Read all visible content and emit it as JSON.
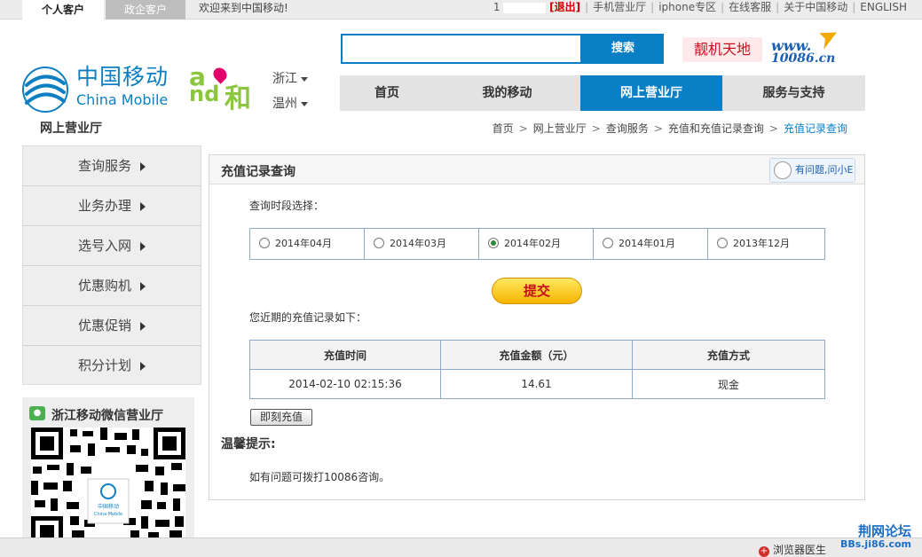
{
  "topbar": {
    "tabs": [
      "个人客户",
      "政企客户"
    ],
    "welcome": "欢迎来到中国移动!",
    "user": "1",
    "logout": "[退出]",
    "links": [
      "手机营业厅",
      "iphone专区",
      "在线客服",
      "关于中国移动",
      "ENGLISH"
    ]
  },
  "logo": {
    "cn": "中国移动",
    "en": "China Mobile"
  },
  "and_logo": {
    "a": "a",
    "nd": "nd",
    "he": "和"
  },
  "region": {
    "province": "浙江",
    "city": "温州"
  },
  "search": {
    "button": "搜索",
    "value": ""
  },
  "promo": {
    "label": "靓机天地",
    "url_line1": "www.",
    "url_line2": "10086.cn"
  },
  "nav": [
    "首页",
    "我的移动",
    "网上营业厅",
    "服务与支持"
  ],
  "page_title": "网上营业厅",
  "breadcrumb": [
    "首页",
    "网上营业厅",
    "查询服务",
    "充值和充值记录查询",
    "充值记录查询"
  ],
  "sidebar": [
    "查询服务",
    "业务办理",
    "选号入网",
    "优惠购机",
    "优惠促销",
    "积分计划"
  ],
  "wechat": {
    "title": "浙江移动微信营业厅",
    "qr_brand_cn": "中国移动",
    "qr_brand_en": "China Mobile"
  },
  "panel": {
    "title": "充值记录查询",
    "help": "有问题,问小E",
    "period_label": "查询时段选择：",
    "periods": [
      "2014年04月",
      "2014年03月",
      "2014年02月",
      "2014年01月",
      "2013年12月"
    ],
    "selected_period": "2014年02月",
    "submit": "提交",
    "records_label": "您近期的充值记录如下：",
    "columns": [
      "充值时间",
      "充值金额（元）",
      "充值方式"
    ],
    "rows": [
      [
        "2014-02-10 02:15:36",
        "14.61",
        "现金"
      ]
    ],
    "recharge_button": "即刻充值",
    "tips_title": "温馨提示:",
    "tips_text": "如有问题可拨打10086咨询。"
  },
  "watermark": {
    "line1": "荆网论坛",
    "line2": "BBs.ji86.com"
  },
  "statusbar": {
    "doctor": "浏览器医生"
  },
  "colors": {
    "primary": "#0b7fc6",
    "accent": "#c8101d",
    "green": "#8cc63f"
  }
}
